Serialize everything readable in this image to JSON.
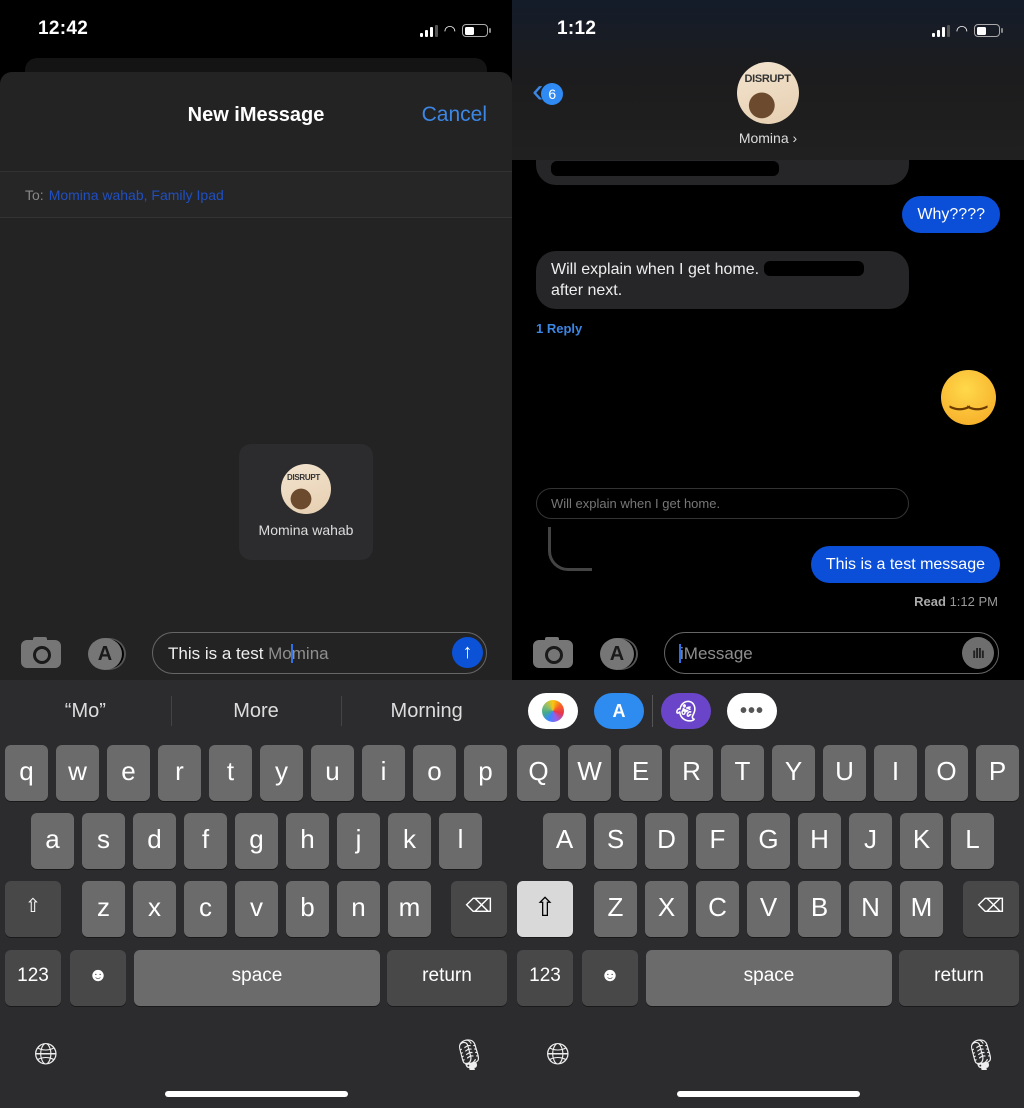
{
  "left": {
    "status": {
      "time": "12:42"
    },
    "sheet": {
      "title": "New iMessage",
      "cancel_label": "Cancel",
      "to_label": "To:",
      "recipients": "Momina wahab, Family Ipad"
    },
    "suggestion": {
      "name": "Momina wahab",
      "avatar_text": "DISRUPT"
    },
    "composer": {
      "typed": "This is a test ",
      "ghost_before_caret": "Mo",
      "ghost_after_caret": "mina",
      "send_icon": "↑"
    },
    "predictions": [
      "“Mo”",
      "More",
      "Morning"
    ],
    "keyboard": {
      "row1": [
        "q",
        "w",
        "e",
        "r",
        "t",
        "y",
        "u",
        "i",
        "o",
        "p"
      ],
      "row2": [
        "a",
        "s",
        "d",
        "f",
        "g",
        "h",
        "j",
        "k",
        "l"
      ],
      "row3": [
        "z",
        "x",
        "c",
        "v",
        "b",
        "n",
        "m"
      ],
      "numbers_label": "123",
      "space_label": "space",
      "return_label": "return"
    }
  },
  "right": {
    "status": {
      "time": "1:12"
    },
    "header": {
      "back_badge": "6",
      "contact_name": "Momina ›",
      "avatar_text": "DISRUPT"
    },
    "messages": [
      {
        "dir": "in",
        "text": "[redacted]"
      },
      {
        "dir": "out",
        "text": "Why????"
      },
      {
        "dir": "in",
        "text_before": "Will explain when I get home.",
        "text_after": "after next."
      },
      {
        "dir": "out",
        "text": "😒"
      },
      {
        "dir": "out",
        "text": "This is a test message"
      }
    ],
    "reply_count_label": "1 Reply",
    "reply_preview": "Will explain when I get home. ",
    "read_receipt": {
      "label": "Read",
      "time": "1:12 PM"
    },
    "composer": {
      "placeholder": "iMessage"
    },
    "app_drawer": [
      "photos",
      "app-store",
      "ghost-app",
      "more"
    ],
    "keyboard": {
      "row1": [
        "Q",
        "W",
        "E",
        "R",
        "T",
        "Y",
        "U",
        "I",
        "O",
        "P"
      ],
      "row2": [
        "A",
        "S",
        "D",
        "F",
        "G",
        "H",
        "J",
        "K",
        "L"
      ],
      "row3": [
        "Z",
        "X",
        "C",
        "V",
        "B",
        "N",
        "M"
      ],
      "numbers_label": "123",
      "space_label": "space",
      "return_label": "return"
    }
  },
  "colors": {
    "accent": "#3c86e4",
    "bubble_out": "#0b4ed8",
    "bubble_in": "#262628",
    "key": "#6b6b6b"
  }
}
